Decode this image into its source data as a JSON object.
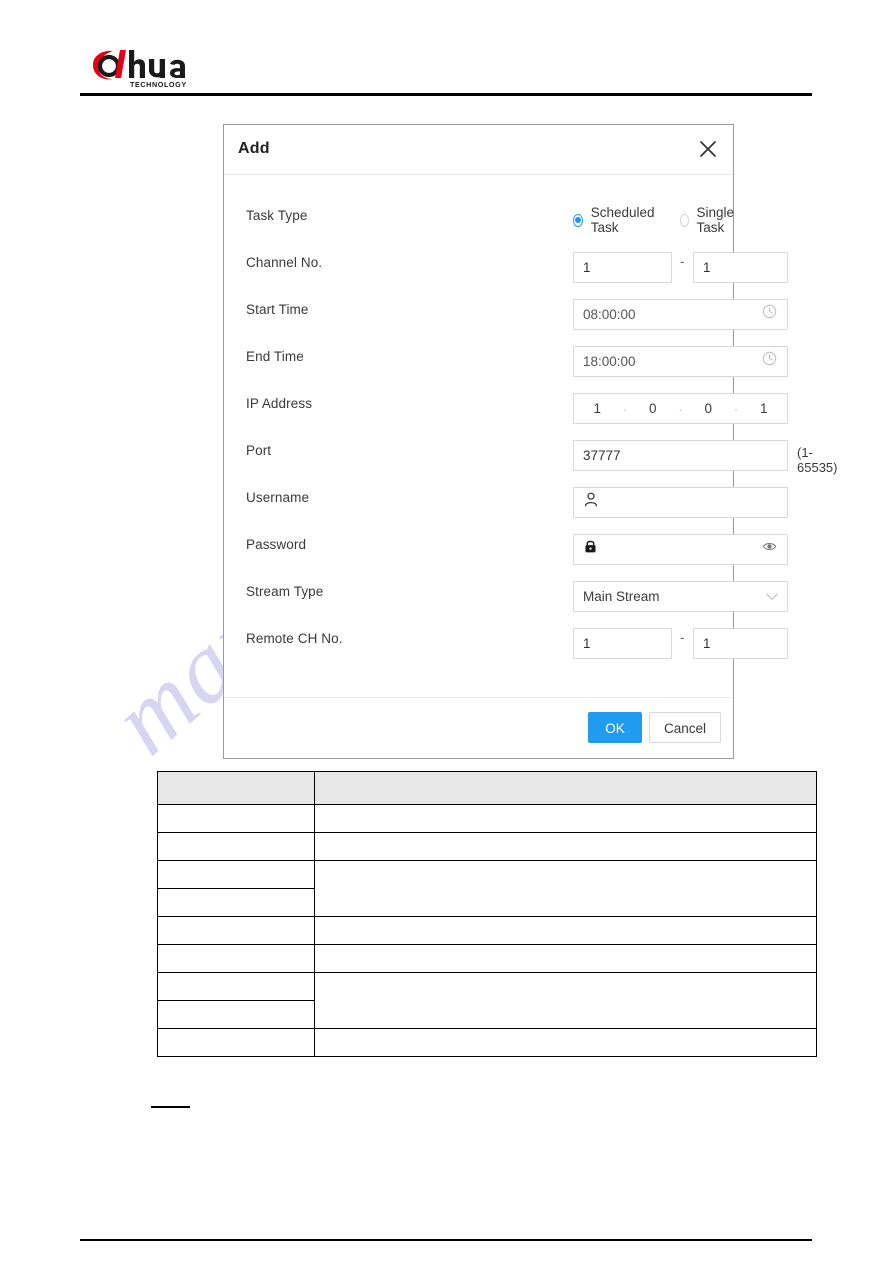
{
  "page": {
    "brand": {
      "name": "alhua",
      "tagline": "TECHNOLOGY"
    },
    "watermark": "manualshive.com"
  },
  "dialog": {
    "title": "Add",
    "close_icon": "close-icon",
    "fields": {
      "task_type": {
        "label": "Task Type",
        "options": [
          {
            "label": "Scheduled Task",
            "selected": true
          },
          {
            "label": "Single Task",
            "selected": false
          }
        ]
      },
      "channel_no": {
        "label": "Channel No.",
        "start": "1",
        "separator": "-",
        "end": "1"
      },
      "start_time": {
        "label": "Start Time",
        "value": "08:00:00",
        "icon": "clock-icon"
      },
      "end_time": {
        "label": "End Time",
        "value": "18:00:00",
        "icon": "clock-icon"
      },
      "ip_address": {
        "label": "IP Address",
        "segments": [
          "1",
          "0",
          "0",
          "1"
        ],
        "separator": "."
      },
      "port": {
        "label": "Port",
        "value": "37777",
        "hint": "(1-65535)"
      },
      "username": {
        "label": "Username",
        "value": "",
        "icon": "user-icon"
      },
      "password": {
        "label": "Password",
        "value": "",
        "icon": "lock-icon",
        "reveal_icon": "eye-icon"
      },
      "stream_type": {
        "label": "Stream Type",
        "value": "Main Stream",
        "caret_icon": "chevron-down-icon"
      },
      "remote_ch_no": {
        "label": "Remote CH No.",
        "start": "1",
        "separator": "-",
        "end": "1"
      }
    },
    "buttons": {
      "ok": "OK",
      "cancel": "Cancel"
    }
  },
  "table": {
    "headers": [
      "",
      ""
    ],
    "rows": [
      {
        "cells": [
          "",
          ""
        ]
      },
      {
        "cells": [
          "",
          ""
        ]
      },
      {
        "cells": [
          "",
          ""
        ]
      },
      {
        "cells": [
          "",
          ""
        ]
      },
      {
        "cells": [
          "",
          ""
        ]
      },
      {
        "cells": [
          "",
          ""
        ]
      },
      {
        "cells": [
          "",
          ""
        ]
      },
      {
        "cells": [
          "",
          ""
        ]
      },
      {
        "cells": [
          "",
          ""
        ]
      }
    ]
  },
  "colors": {
    "accent": "#1f9bf0",
    "radio_selected": "#2196f3",
    "logo_red": "#e60012",
    "table_header_bg": "#e7e7e7",
    "watermark": "#c9c6ee"
  }
}
